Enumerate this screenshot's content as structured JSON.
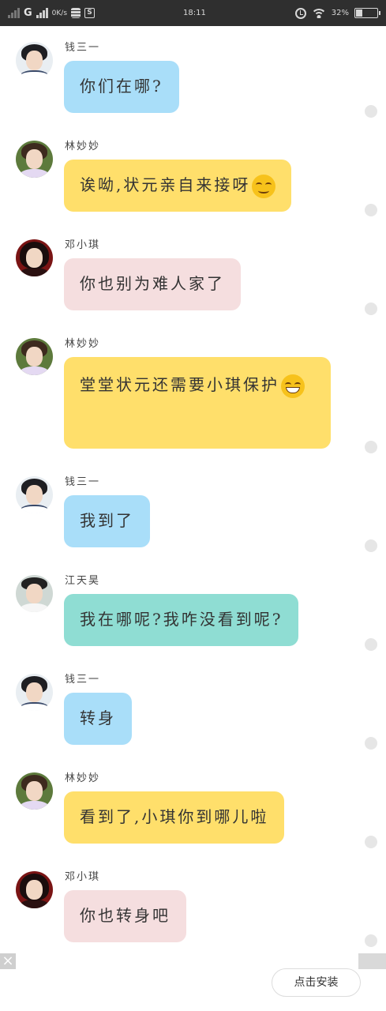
{
  "status_bar": {
    "network": "G",
    "speed": "0K/s",
    "sim_icon": "S",
    "center_text": "18:11",
    "battery_text": "32%",
    "battery_level": 0.32
  },
  "messages": [
    {
      "sender": "钱三一",
      "avatar": "qian",
      "text": "你们在哪?",
      "color": "#a9def9",
      "emoji": ""
    },
    {
      "sender": "林妙妙",
      "avatar": "lin",
      "text": "诶呦,状元亲自来接呀",
      "color": "#ffdf6b",
      "emoji": "smile"
    },
    {
      "sender": "邓小琪",
      "avatar": "deng",
      "text": "你也别为难人家了",
      "color": "#f5dedf",
      "emoji": ""
    },
    {
      "sender": "林妙妙",
      "avatar": "lin",
      "text": "堂堂状元还需要小琪保护",
      "color": "#ffdf6b",
      "emoji": "grin"
    },
    {
      "sender": "钱三一",
      "avatar": "qian",
      "text": "我到了",
      "color": "#a9def9",
      "emoji": ""
    },
    {
      "sender": "江天昊",
      "avatar": "jiang",
      "text": "我在哪呢?我咋没看到呢?",
      "color": "#8fddd3",
      "emoji": ""
    },
    {
      "sender": "钱三一",
      "avatar": "qian",
      "text": "转身",
      "color": "#a9def9",
      "emoji": ""
    },
    {
      "sender": "林妙妙",
      "avatar": "lin",
      "text": "看到了,小琪你到哪儿啦",
      "color": "#ffdf6b",
      "emoji": ""
    },
    {
      "sender": "邓小琪",
      "avatar": "deng",
      "text": "你也转身吧",
      "color": "#f5dedf",
      "emoji": ""
    }
  ],
  "ad": {
    "install_label": "点击安装",
    "close_glyph": "×"
  }
}
